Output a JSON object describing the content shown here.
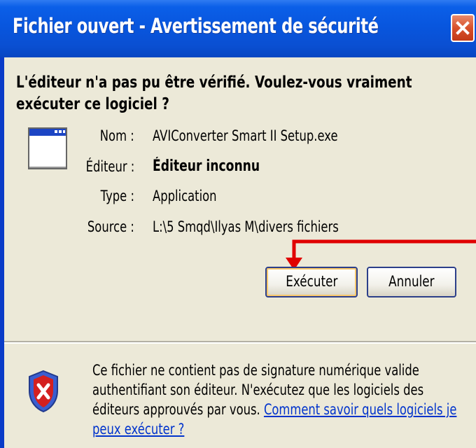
{
  "window": {
    "title": "Fichier ouvert - Avertissement de sécurité"
  },
  "dialog": {
    "question": "L'éditeur n'a pas pu être vérifié. Voulez-vous vraiment exécuter ce logiciel ?",
    "fields": {
      "name_label": "Nom :",
      "name_value": "AVIConverter Smart II Setup.exe",
      "publisher_label": "Éditeur :",
      "publisher_value": "Éditeur inconnu",
      "type_label": "Type :",
      "type_value": "Application",
      "source_label": "Source :",
      "source_value": "L:\\5 Smqd\\Ilyas M\\divers fichiers"
    },
    "buttons": {
      "run_label": "Exécuter",
      "cancel_label": "Annuler"
    },
    "warning": {
      "text": "Ce fichier ne contient pas de signature numérique valide authentifiant son éditeur. N'exécutez que les logiciels des éditeurs approuvés par vous.",
      "link": "Comment savoir quels logiciels je peux exécuter ?"
    }
  },
  "colors": {
    "title_bar": "#0856de",
    "dialog_bg": "#ece9d8",
    "arrow": "#e00000",
    "link": "#0033cc"
  },
  "icons": {
    "app": "window-application-icon",
    "shield": "shield-warning-icon",
    "close": "close-icon"
  }
}
